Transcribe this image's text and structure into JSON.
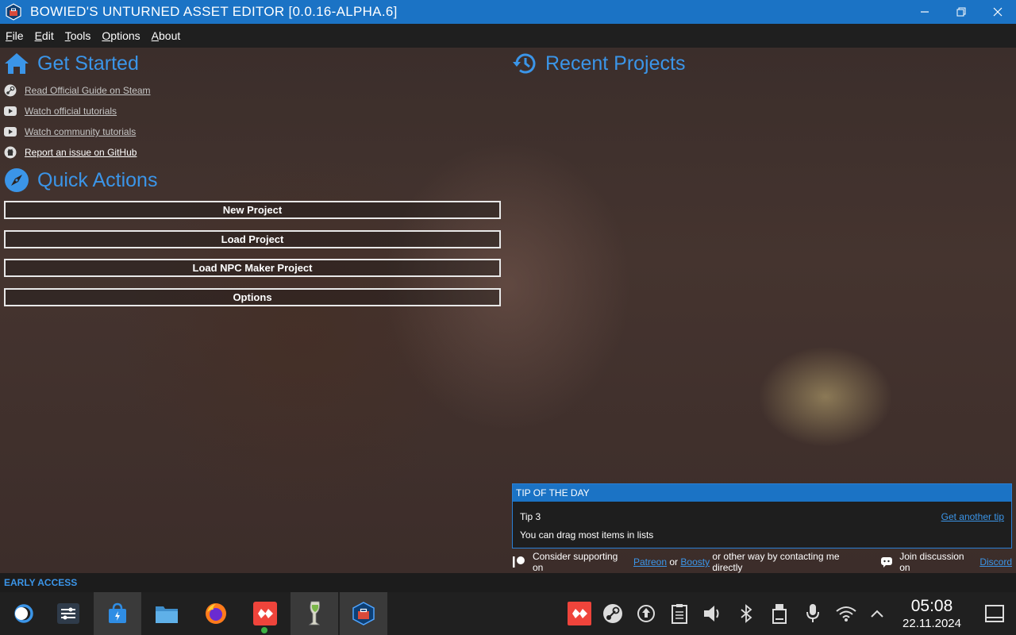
{
  "window": {
    "title": "BOWIED'S UNTURNED ASSET EDITOR [0.0.16-ALPHA.6]",
    "app_icon": "toolbox-icon",
    "controls": [
      "minimize-icon",
      "restore-icon",
      "close-icon"
    ]
  },
  "menu": [
    "File",
    "Edit",
    "Tools",
    "Options",
    "About"
  ],
  "get_started": {
    "title": "Get Started",
    "icon": "home-icon",
    "links": [
      {
        "label": "Read Official Guide on Steam",
        "icon": "steam-icon"
      },
      {
        "label": "Watch official tutorials",
        "icon": "youtube-icon"
      },
      {
        "label": "Watch community tutorials",
        "icon": "youtube-icon"
      },
      {
        "label": "Report an issue on GitHub",
        "icon": "github-icon"
      }
    ]
  },
  "quick_actions": {
    "title": "Quick Actions",
    "icon": "compass-icon",
    "buttons": [
      "New Project",
      "Load Project",
      "Load NPC Maker Project",
      "Options"
    ]
  },
  "recent_projects": {
    "title": "Recent Projects",
    "icon": "history-icon"
  },
  "tip": {
    "header": "TIP OF THE DAY",
    "number": "Tip 3",
    "text": "You can drag most items in lists",
    "another": "Get another tip"
  },
  "support": {
    "prefix": "Consider supporting on",
    "patreon": "Patreon",
    "or": "or",
    "boosty": "Boosty",
    "suffix": "or other way by contacting me directly",
    "discord_prefix": "Join discussion on",
    "discord": "Discord"
  },
  "status": {
    "label": "EARLY ACCESS"
  },
  "taskbar": {
    "apps": [
      "start-menu-icon",
      "system-settings-icon",
      "app-store-icon",
      "file-manager-icon",
      "firefox-icon",
      "anydesk-icon",
      "wine-icon",
      "asset-editor-icon"
    ],
    "tray": [
      "anydesk-tray-icon",
      "steam-tray-icon",
      "update-icon",
      "clipboard-icon",
      "volume-icon",
      "bluetooth-icon",
      "storage-icon",
      "microphone-icon",
      "wifi-icon",
      "chevron-up-icon"
    ],
    "time": "05:08",
    "date": "22.11.2024"
  },
  "colors": {
    "accent": "#1b73c5",
    "link_blue": "#3b95e8"
  }
}
